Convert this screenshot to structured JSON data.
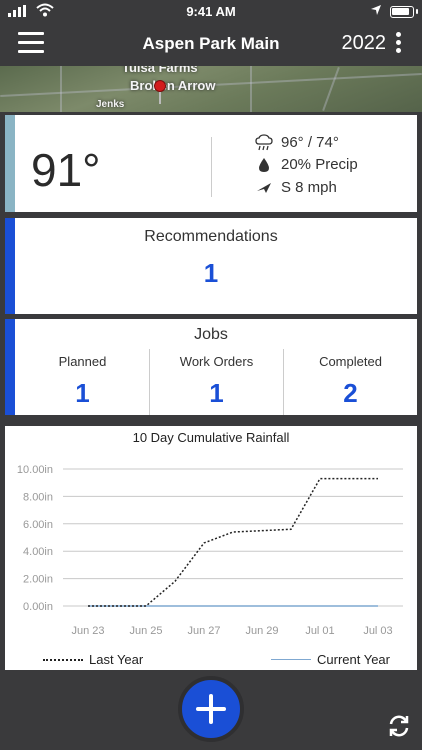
{
  "status_bar": {
    "time": "9:41 AM"
  },
  "nav": {
    "title": "Aspen Park Main",
    "year": "2022",
    "menu_icon": "hamburger-icon",
    "more_icon": "vertical-dots-icon"
  },
  "map": {
    "label_top": "Tulsa Farms",
    "label_city": "Broken Arrow",
    "label_small": "Jenks"
  },
  "weather": {
    "temperature": "91°",
    "hi_lo": "96° /  74°",
    "precip": "20% Precip",
    "wind": "S 8 mph",
    "icons": [
      "rain-cloud-icon",
      "droplet-icon",
      "wind-direction-icon"
    ]
  },
  "recommendations": {
    "heading": "Recommendations",
    "count": "1"
  },
  "jobs": {
    "heading": "Jobs",
    "columns": [
      {
        "label": "Planned",
        "value": "1"
      },
      {
        "label": "Work Orders",
        "value": "1"
      },
      {
        "label": "Completed",
        "value": "2"
      }
    ]
  },
  "colors": {
    "accent_blue": "#1a4fd6",
    "weather_accent": "#8ab4c4",
    "chrome": "#3a3a3c",
    "current_year_line": "#7fa8d1"
  },
  "chart_data": {
    "type": "line",
    "title": "10 Day Cumulative Rainfall",
    "xlabel": "",
    "ylabel": "",
    "ylim": [
      0,
      10
    ],
    "y_ticks": [
      "0.00in",
      "2.00in",
      "4.00in",
      "6.00in",
      "8.00in",
      "10.00in"
    ],
    "x_ticks": [
      "Jun 23",
      "Jun 25",
      "Jun 27",
      "Jun 29",
      "Jul 01",
      "Jul 03"
    ],
    "x": [
      "Jun 23",
      "Jun 24",
      "Jun 25",
      "Jun 26",
      "Jun 27",
      "Jun 28",
      "Jun 29",
      "Jun 30",
      "Jul 01",
      "Jul 02",
      "Jul 03"
    ],
    "series": [
      {
        "name": "Last Year",
        "style": "dotted",
        "values": [
          0,
          0,
          0,
          1.8,
          4.6,
          5.4,
          5.5,
          5.6,
          9.3,
          9.3,
          9.3
        ]
      },
      {
        "name": "Current Year",
        "style": "solid",
        "values": [
          0,
          0,
          0,
          0,
          0,
          0,
          0,
          0,
          0,
          0,
          0
        ]
      }
    ],
    "grid": true,
    "legend": "bottom"
  }
}
